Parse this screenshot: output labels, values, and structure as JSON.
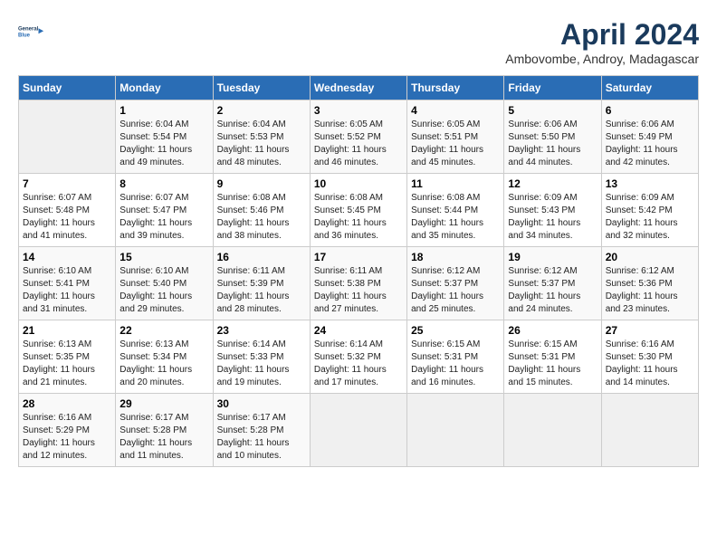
{
  "header": {
    "logo_line1": "General",
    "logo_line2": "Blue",
    "month": "April 2024",
    "location": "Ambovombe, Androy, Madagascar"
  },
  "days_of_week": [
    "Sunday",
    "Monday",
    "Tuesday",
    "Wednesday",
    "Thursday",
    "Friday",
    "Saturday"
  ],
  "weeks": [
    [
      {
        "day": "",
        "sunrise": "",
        "sunset": "",
        "daylight": ""
      },
      {
        "day": "1",
        "sunrise": "Sunrise: 6:04 AM",
        "sunset": "Sunset: 5:54 PM",
        "daylight": "Daylight: 11 hours and 49 minutes."
      },
      {
        "day": "2",
        "sunrise": "Sunrise: 6:04 AM",
        "sunset": "Sunset: 5:53 PM",
        "daylight": "Daylight: 11 hours and 48 minutes."
      },
      {
        "day": "3",
        "sunrise": "Sunrise: 6:05 AM",
        "sunset": "Sunset: 5:52 PM",
        "daylight": "Daylight: 11 hours and 46 minutes."
      },
      {
        "day": "4",
        "sunrise": "Sunrise: 6:05 AM",
        "sunset": "Sunset: 5:51 PM",
        "daylight": "Daylight: 11 hours and 45 minutes."
      },
      {
        "day": "5",
        "sunrise": "Sunrise: 6:06 AM",
        "sunset": "Sunset: 5:50 PM",
        "daylight": "Daylight: 11 hours and 44 minutes."
      },
      {
        "day": "6",
        "sunrise": "Sunrise: 6:06 AM",
        "sunset": "Sunset: 5:49 PM",
        "daylight": "Daylight: 11 hours and 42 minutes."
      }
    ],
    [
      {
        "day": "7",
        "sunrise": "Sunrise: 6:07 AM",
        "sunset": "Sunset: 5:48 PM",
        "daylight": "Daylight: 11 hours and 41 minutes."
      },
      {
        "day": "8",
        "sunrise": "Sunrise: 6:07 AM",
        "sunset": "Sunset: 5:47 PM",
        "daylight": "Daylight: 11 hours and 39 minutes."
      },
      {
        "day": "9",
        "sunrise": "Sunrise: 6:08 AM",
        "sunset": "Sunset: 5:46 PM",
        "daylight": "Daylight: 11 hours and 38 minutes."
      },
      {
        "day": "10",
        "sunrise": "Sunrise: 6:08 AM",
        "sunset": "Sunset: 5:45 PM",
        "daylight": "Daylight: 11 hours and 36 minutes."
      },
      {
        "day": "11",
        "sunrise": "Sunrise: 6:08 AM",
        "sunset": "Sunset: 5:44 PM",
        "daylight": "Daylight: 11 hours and 35 minutes."
      },
      {
        "day": "12",
        "sunrise": "Sunrise: 6:09 AM",
        "sunset": "Sunset: 5:43 PM",
        "daylight": "Daylight: 11 hours and 34 minutes."
      },
      {
        "day": "13",
        "sunrise": "Sunrise: 6:09 AM",
        "sunset": "Sunset: 5:42 PM",
        "daylight": "Daylight: 11 hours and 32 minutes."
      }
    ],
    [
      {
        "day": "14",
        "sunrise": "Sunrise: 6:10 AM",
        "sunset": "Sunset: 5:41 PM",
        "daylight": "Daylight: 11 hours and 31 minutes."
      },
      {
        "day": "15",
        "sunrise": "Sunrise: 6:10 AM",
        "sunset": "Sunset: 5:40 PM",
        "daylight": "Daylight: 11 hours and 29 minutes."
      },
      {
        "day": "16",
        "sunrise": "Sunrise: 6:11 AM",
        "sunset": "Sunset: 5:39 PM",
        "daylight": "Daylight: 11 hours and 28 minutes."
      },
      {
        "day": "17",
        "sunrise": "Sunrise: 6:11 AM",
        "sunset": "Sunset: 5:38 PM",
        "daylight": "Daylight: 11 hours and 27 minutes."
      },
      {
        "day": "18",
        "sunrise": "Sunrise: 6:12 AM",
        "sunset": "Sunset: 5:37 PM",
        "daylight": "Daylight: 11 hours and 25 minutes."
      },
      {
        "day": "19",
        "sunrise": "Sunrise: 6:12 AM",
        "sunset": "Sunset: 5:37 PM",
        "daylight": "Daylight: 11 hours and 24 minutes."
      },
      {
        "day": "20",
        "sunrise": "Sunrise: 6:12 AM",
        "sunset": "Sunset: 5:36 PM",
        "daylight": "Daylight: 11 hours and 23 minutes."
      }
    ],
    [
      {
        "day": "21",
        "sunrise": "Sunrise: 6:13 AM",
        "sunset": "Sunset: 5:35 PM",
        "daylight": "Daylight: 11 hours and 21 minutes."
      },
      {
        "day": "22",
        "sunrise": "Sunrise: 6:13 AM",
        "sunset": "Sunset: 5:34 PM",
        "daylight": "Daylight: 11 hours and 20 minutes."
      },
      {
        "day": "23",
        "sunrise": "Sunrise: 6:14 AM",
        "sunset": "Sunset: 5:33 PM",
        "daylight": "Daylight: 11 hours and 19 minutes."
      },
      {
        "day": "24",
        "sunrise": "Sunrise: 6:14 AM",
        "sunset": "Sunset: 5:32 PM",
        "daylight": "Daylight: 11 hours and 17 minutes."
      },
      {
        "day": "25",
        "sunrise": "Sunrise: 6:15 AM",
        "sunset": "Sunset: 5:31 PM",
        "daylight": "Daylight: 11 hours and 16 minutes."
      },
      {
        "day": "26",
        "sunrise": "Sunrise: 6:15 AM",
        "sunset": "Sunset: 5:31 PM",
        "daylight": "Daylight: 11 hours and 15 minutes."
      },
      {
        "day": "27",
        "sunrise": "Sunrise: 6:16 AM",
        "sunset": "Sunset: 5:30 PM",
        "daylight": "Daylight: 11 hours and 14 minutes."
      }
    ],
    [
      {
        "day": "28",
        "sunrise": "Sunrise: 6:16 AM",
        "sunset": "Sunset: 5:29 PM",
        "daylight": "Daylight: 11 hours and 12 minutes."
      },
      {
        "day": "29",
        "sunrise": "Sunrise: 6:17 AM",
        "sunset": "Sunset: 5:28 PM",
        "daylight": "Daylight: 11 hours and 11 minutes."
      },
      {
        "day": "30",
        "sunrise": "Sunrise: 6:17 AM",
        "sunset": "Sunset: 5:28 PM",
        "daylight": "Daylight: 11 hours and 10 minutes."
      },
      {
        "day": "",
        "sunrise": "",
        "sunset": "",
        "daylight": ""
      },
      {
        "day": "",
        "sunrise": "",
        "sunset": "",
        "daylight": ""
      },
      {
        "day": "",
        "sunrise": "",
        "sunset": "",
        "daylight": ""
      },
      {
        "day": "",
        "sunrise": "",
        "sunset": "",
        "daylight": ""
      }
    ]
  ]
}
